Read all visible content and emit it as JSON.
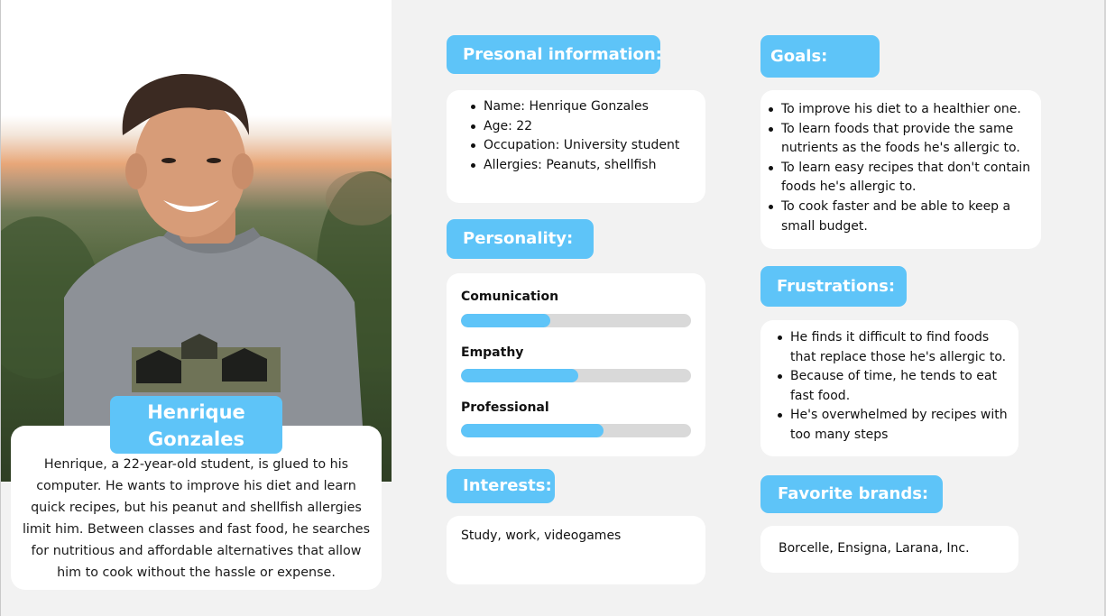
{
  "persona": {
    "name": "Henrique Gonzales",
    "bio": "Henrique, a 22-year-old student, is glued to his computer. He wants to improve his diet and learn quick recipes, but his peanut and shellfish allergies limit him. Between classes and fast food, he searches for nutritious and affordable alternatives that allow him to cook without the hassle or expense."
  },
  "personal_info": {
    "title": "Presonal information:",
    "items": [
      "Name: Henrique Gonzales",
      "Age: 22",
      "Occupation: University student",
      "Allergies: Peanuts, shellfish"
    ]
  },
  "personality": {
    "title": "Personality:",
    "traits": [
      {
        "label": "Comunication",
        "level": 0.39
      },
      {
        "label": "Empathy",
        "level": 0.51
      },
      {
        "label": "Professional",
        "level": 0.62
      }
    ]
  },
  "interests": {
    "title": "Interests:",
    "text": "Study, work, videogames"
  },
  "goals": {
    "title": "Goals:",
    "items": [
      "To improve his diet to a healthier one.",
      "To learn foods that provide the same nutrients as the foods he's allergic to.",
      "To learn easy recipes that don't contain foods he's allergic to.",
      "To cook faster and be able to keep a small budget."
    ]
  },
  "frustrations": {
    "title": "Frustrations:",
    "items": [
      "He finds it difficult to find foods that replace those he's allergic to.",
      "Because of time, he tends to eat fast food.",
      "He's overwhelmed by recipes with too many steps"
    ]
  },
  "brands": {
    "title": "Favorite brands:",
    "text": "Borcelle, Ensigna, Larana, Inc."
  },
  "colors": {
    "accent": "#5ec4f8",
    "background": "#f2f2f2",
    "card": "#ffffff",
    "track": "#d9d9d9"
  }
}
